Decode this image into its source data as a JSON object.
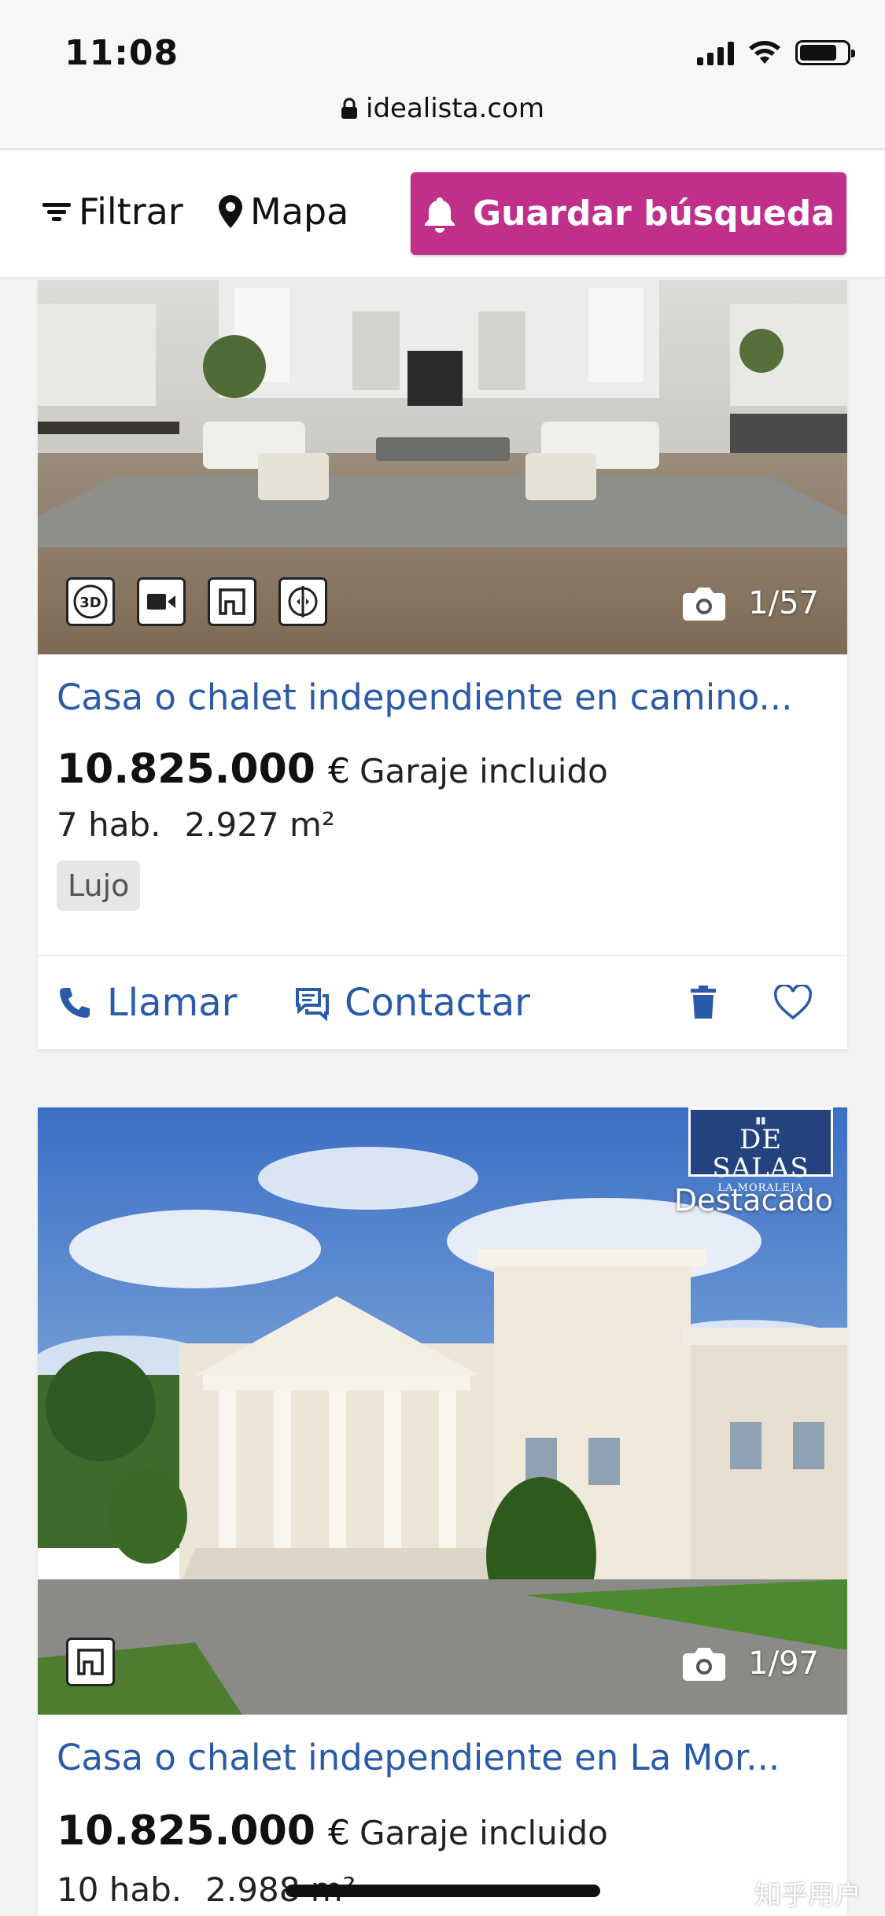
{
  "status_bar": {
    "time": "11:08"
  },
  "browser": {
    "url": "idealista.com"
  },
  "toolbar": {
    "filter_label": "Filtrar",
    "map_label": "Mapa",
    "save_search_label": "Guardar búsqueda"
  },
  "listings": [
    {
      "title": "Casa o chalet independiente en camino...",
      "price": "10.825.000",
      "currency": "€",
      "extra": "Garaje incluido",
      "rooms": "7 hab.",
      "area": "2.927 m²",
      "tag": "Lujo",
      "photo_counter": "1/57",
      "media_badges": [
        "3D",
        "video-icon",
        "floorplan-icon",
        "virtual-tour-icon"
      ],
      "actions": {
        "call": "Llamar",
        "contact": "Contactar"
      }
    },
    {
      "title": "Casa o chalet independiente en La Mor...",
      "price": "10.825.000",
      "currency": "€",
      "extra": "Garaje incluido",
      "rooms": "10 hab.",
      "area": "2.988 m²",
      "photo_counter": "1/97",
      "agency": {
        "line1": "DE SALAS",
        "line2": "LA MORALEJA"
      },
      "featured_label": "Destacado",
      "media_badges": [
        "floorplan-icon"
      ]
    }
  ],
  "watermark": "知乎用户",
  "colors": {
    "accent": "#c0308b",
    "link": "#2a5aa8"
  }
}
